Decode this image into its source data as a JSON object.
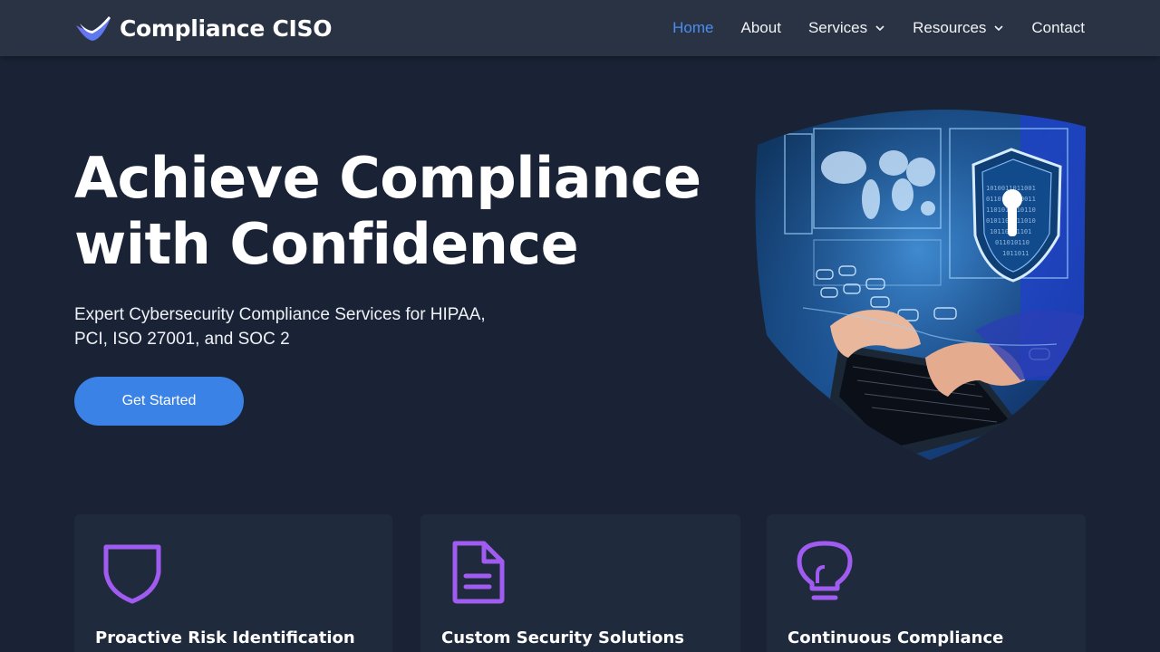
{
  "brand": {
    "name": "Compliance CISO",
    "logo_icon": "check-ribbon-icon",
    "accent": "#3b82e6"
  },
  "nav": {
    "items": [
      {
        "label": "Home",
        "active": true
      },
      {
        "label": "About"
      },
      {
        "label": "Services",
        "dropdown": true
      },
      {
        "label": "Resources",
        "dropdown": true
      },
      {
        "label": "Contact"
      }
    ]
  },
  "hero": {
    "title_line1": "Achieve Compliance",
    "title_line2": "with Confidence",
    "subtitle_line1": "Expert Cybersecurity Compliance Services for HIPAA,",
    "subtitle_line2": "PCI, ISO 27001, and SOC 2",
    "cta_label": "Get Started",
    "image_icon": "shield-lock-laptop-image"
  },
  "features": [
    {
      "title": "Proactive Risk Identification",
      "icon": "shield-icon"
    },
    {
      "title": "Custom Security Solutions",
      "icon": "document-icon"
    },
    {
      "title": "Continuous Compliance",
      "icon": "lightbulb-icon"
    }
  ],
  "colors": {
    "background": "#1a2335",
    "header": "#2a3344",
    "card": "#1f2a3d",
    "icon_purple": "#a05cf0",
    "nav_active": "#4a8df0"
  }
}
